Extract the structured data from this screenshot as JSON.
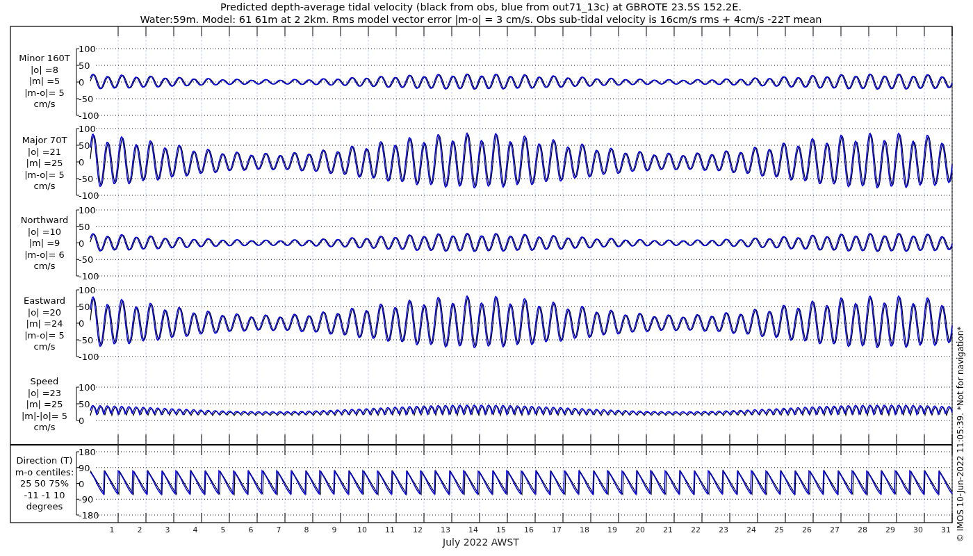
{
  "title": [
    "Predicted depth-average tidal velocity (black from obs, blue from out71_13c) at GBROTE 23.5S 152.2E.",
    "Water:59m. Model: 61 61m at 2 2km. Rms model vector error |m-o| = 3 cm/s. Obs sub-tidal velocity is 16cm/s rms + 4cm/s -22T mean"
  ],
  "panels": [
    {
      "kind": "velocity",
      "label": [
        "Minor 160T",
        "|o| =8",
        "|m| =5",
        "|m-o|= 5",
        "cm/s"
      ],
      "yticks": [
        "100",
        "50",
        "0",
        "-50",
        "-100"
      ]
    },
    {
      "kind": "velocity",
      "label": [
        "Major 70T",
        "|o| =21",
        "|m| =25",
        "|m-o|= 5",
        "cm/s"
      ],
      "yticks": [
        "100",
        "50",
        "0",
        "-50",
        "-100"
      ]
    },
    {
      "kind": "velocity",
      "label": [
        "Northward",
        "|o| =10",
        "|m| =9",
        "|m-o|= 6",
        "cm/s"
      ],
      "yticks": [
        "100",
        "50",
        "0",
        "-50",
        "-100"
      ]
    },
    {
      "kind": "velocity",
      "label": [
        "Eastward",
        "|o| =20",
        "|m| =24",
        "|m-o|= 5",
        "cm/s"
      ],
      "yticks": [
        "100",
        "50",
        "0",
        "-50",
        "-100"
      ]
    },
    {
      "kind": "speed",
      "label": [
        "Speed",
        "|o| =23",
        "|m| =25",
        "|m|-|o|= 5",
        "cm/s"
      ],
      "yticks": [
        "100",
        "50",
        "0"
      ]
    },
    {
      "kind": "direction",
      "label": [
        "Direction (T)",
        "m-o centiles:",
        "25  50  75%",
        "-11  -1  10",
        "degrees"
      ],
      "yticks": [
        "180",
        "90",
        "0",
        "-90",
        "-180"
      ]
    }
  ],
  "xticks": [
    "1",
    "2",
    "3",
    "4",
    "5",
    "6",
    "7",
    "8",
    "9",
    "10",
    "11",
    "12",
    "13",
    "14",
    "15",
    "16",
    "17",
    "18",
    "19",
    "20",
    "21",
    "22",
    "23",
    "24",
    "25",
    "26",
    "27",
    "28",
    "29",
    "30",
    "31"
  ],
  "xlabel": "July 2022 AWST",
  "credit": "© IMOS 10-Jun-2022 11:05:39. *Not for navigation*"
}
